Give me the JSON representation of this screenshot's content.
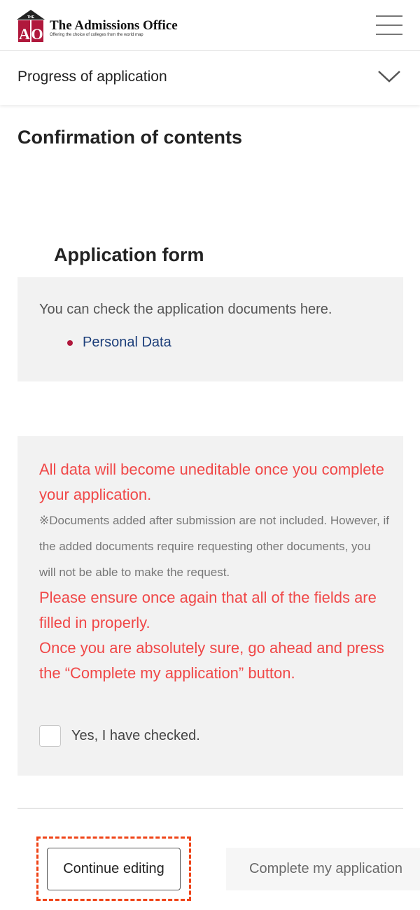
{
  "header": {
    "logo_top": "THE",
    "logo_letters": "AO",
    "brand_title": "The Admissions Office",
    "brand_tagline": "Offering the choice of colleges from the world map",
    "brand_color": "#b0183c"
  },
  "progress": {
    "label": "Progress of application"
  },
  "page": {
    "title": "Confirmation of contents"
  },
  "application_form": {
    "title": "Application form",
    "intro": "You can check the application documents here.",
    "documents": [
      {
        "label": "Personal Data"
      }
    ]
  },
  "warning": {
    "line1": "All data will become uneditable once you complete your application.",
    "note": "※Documents added after submission are not included. However, if the added documents require requesting other documents, you will not be able to make the request.",
    "line2": "Please ensure once again that all of the fields are filled in properly.",
    "line3": "Once you are absolutely sure, go ahead and press the “Complete my application” button.",
    "checkbox_label": "Yes, I have checked.",
    "checkbox_checked": false,
    "warn_color": "#f04848"
  },
  "actions": {
    "continue_label": "Continue editing",
    "complete_label": "Complete my application",
    "highlight_color": "#ef4317"
  }
}
